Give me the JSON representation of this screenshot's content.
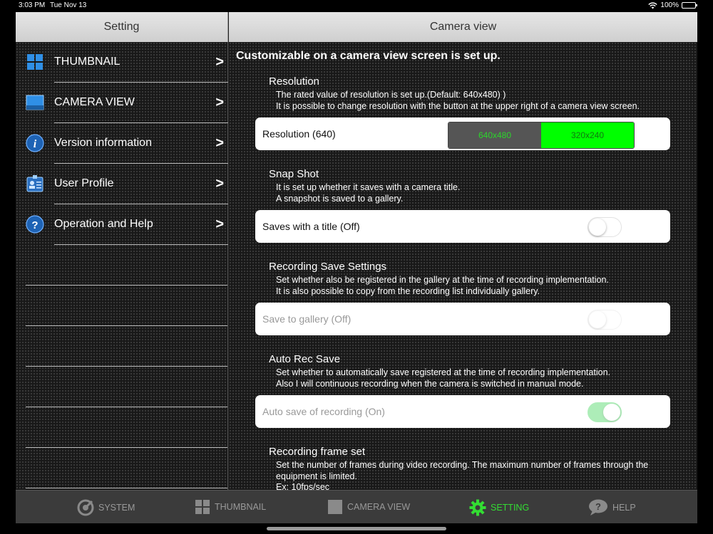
{
  "status": {
    "time": "3:03 PM",
    "date": "Tue Nov 13",
    "battery": "100%"
  },
  "header": {
    "left_title": "Setting",
    "right_title": "Camera view"
  },
  "sidebar": {
    "items": [
      {
        "label": "THUMBNAIL",
        "icon": "thumbnail-grid-icon",
        "chevron": ">"
      },
      {
        "label": "CAMERA VIEW",
        "icon": "camera-view-icon",
        "chevron": ">"
      },
      {
        "label": "Version information",
        "icon": "info-icon",
        "chevron": ">"
      },
      {
        "label": "User Profile",
        "icon": "user-profile-icon",
        "chevron": ">"
      },
      {
        "label": "Operation and Help",
        "icon": "help-icon",
        "chevron": ">"
      }
    ]
  },
  "content": {
    "headline": "Customizable on a camera view screen is set up.",
    "resolution": {
      "title": "Resolution",
      "desc1": "The rated value of resolution is set up.(Default: 640x480) )",
      "desc2": "It is possible to change resolution with the button at the upper right of a camera view screen.",
      "label": "Resolution (640)",
      "options": [
        "640x480",
        "320x240"
      ],
      "selected": "320x240"
    },
    "snapshot": {
      "title": "Snap Shot",
      "desc1": "It is set up whether it saves with a camera title.",
      "desc2": "A snapshot is saved to a gallery.",
      "label": "Saves with a title (Off)",
      "on": false
    },
    "recording": {
      "title": "Recording Save Settings",
      "desc1": "Set whether also be registered in the gallery at the time of recording implementation.",
      "desc2": "It is also possible to copy from the recording list individually gallery.",
      "label": "Save to gallery (Off)",
      "on": false
    },
    "autorec": {
      "title": "Auto Rec Save",
      "desc1": "Set whether to automatically save registered at the time of recording implementation.",
      "desc2": "Also I will continuous recording when the camera is switched in manual mode.",
      "label": "Auto save of recording (On)",
      "on": true
    },
    "frameset": {
      "title": "Recording frame set",
      "desc1": "Set the number of frames during video recording. The maximum number of frames through the equipment is limited.",
      "desc2": "Ex: 10fps/sec"
    }
  },
  "tabbar": {
    "tabs": [
      {
        "label": "SYSTEM",
        "icon": "system-icon",
        "active": false
      },
      {
        "label": "THUMBNAIL",
        "icon": "thumbnail-icon",
        "active": false
      },
      {
        "label": "CAMERA VIEW",
        "icon": "camera-view-icon",
        "active": false
      },
      {
        "label": "SETTING",
        "icon": "gear-icon",
        "active": true
      },
      {
        "label": "HELP",
        "icon": "help-bubble-icon",
        "active": false
      }
    ]
  },
  "colors": {
    "accent_green": "#33dd33",
    "segment_on": "#00ff00",
    "toggle_on": "#4cd964"
  }
}
